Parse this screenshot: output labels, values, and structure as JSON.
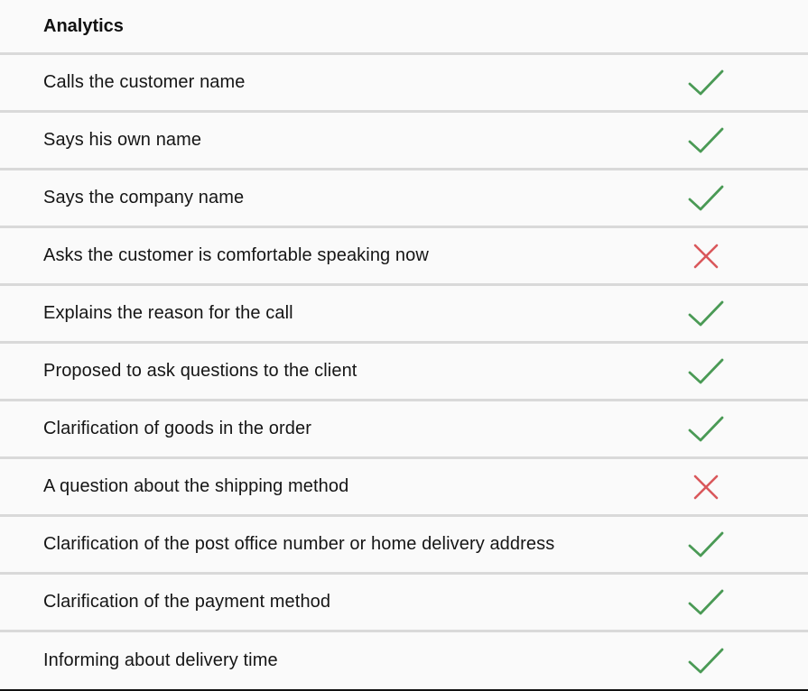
{
  "header": {
    "title": "Analytics"
  },
  "colors": {
    "pass": "#4a9a55",
    "fail": "#d9575b"
  },
  "rows": [
    {
      "label": "Calls the customer name",
      "status": "pass",
      "icon": "check-icon"
    },
    {
      "label": "Says his own name",
      "status": "pass",
      "icon": "check-icon"
    },
    {
      "label": "Says the company name",
      "status": "pass",
      "icon": "check-icon"
    },
    {
      "label": "Asks the customer is comfortable speaking now",
      "status": "fail",
      "icon": "cross-icon"
    },
    {
      "label": "Explains the reason for the call",
      "status": "pass",
      "icon": "check-icon"
    },
    {
      "label": "Proposed to ask questions to the client",
      "status": "pass",
      "icon": "check-icon"
    },
    {
      "label": "Clarification of goods in the order",
      "status": "pass",
      "icon": "check-icon"
    },
    {
      "label": "A question about the shipping method",
      "status": "fail",
      "icon": "cross-icon"
    },
    {
      "label": "Clarification of the post office number or home delivery address",
      "status": "pass",
      "icon": "check-icon"
    },
    {
      "label": "Clarification of the payment method",
      "status": "pass",
      "icon": "check-icon"
    },
    {
      "label": "Informing about delivery time",
      "status": "pass",
      "icon": "check-icon"
    }
  ]
}
